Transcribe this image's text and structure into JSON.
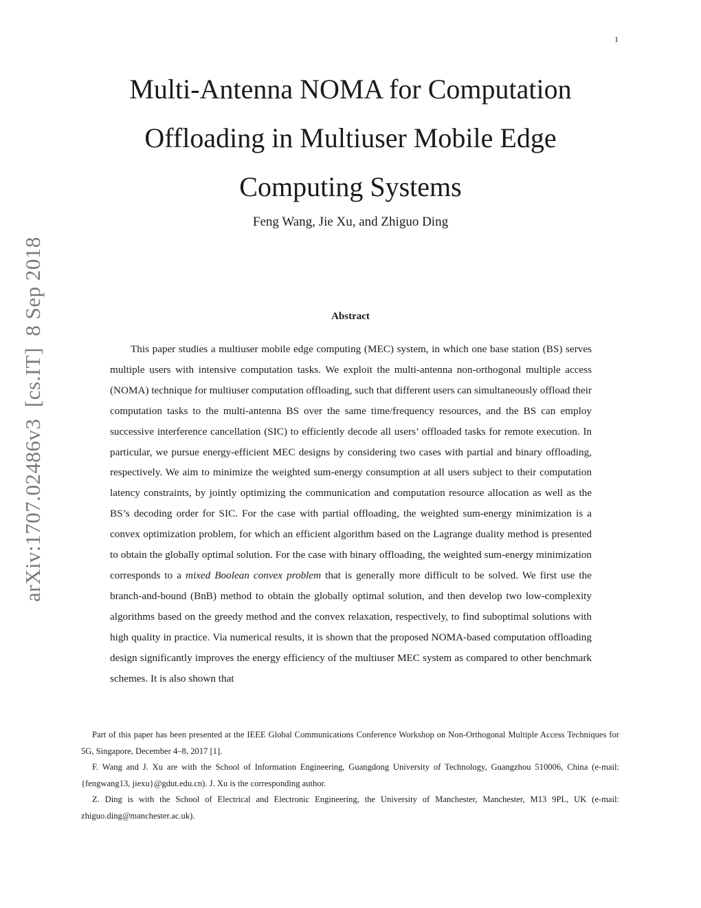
{
  "page_number": "1",
  "arxiv_stamp": "arXiv:1707.02486v3  [cs.IT]  8 Sep 2018",
  "title_lines": [
    "Multi-Antenna NOMA for Computation",
    "Offloading in Multiuser Mobile Edge",
    "Computing Systems"
  ],
  "authors": "Feng Wang, Jie Xu, and Zhiguo Ding",
  "abstract": {
    "heading": "Abstract",
    "text_before_italic": "This paper studies a multiuser mobile edge computing (MEC) system, in which one base station (BS) serves multiple users with intensive computation tasks. We exploit the multi-antenna non-orthogonal multiple access (NOMA) technique for multiuser computation offloading, such that different users can simultaneously offload their computation tasks to the multi-antenna BS over the same time/frequency resources, and the BS can employ successive interference cancellation (SIC) to efficiently decode all users’ offloaded tasks for remote execution. In particular, we pursue energy-efficient MEC designs by considering two cases with partial and binary offloading, respectively. We aim to minimize the weighted sum-energy consumption at all users subject to their computation latency constraints, by jointly optimizing the communication and computation resource allocation as well as the BS’s decoding order for SIC. For the case with partial offloading, the weighted sum-energy minimization is a convex optimization problem, for which an efficient algorithm based on the Lagrange duality method is presented to obtain the globally optimal solution. For the case with binary offloading, the weighted sum-energy minimization corresponds to a ",
    "italic_text": "mixed Boolean convex problem",
    "text_after_italic": " that is generally more difficult to be solved. We first use the branch-and-bound (BnB) method to obtain the globally optimal solution, and then develop two low-complexity algorithms based on the greedy method and the convex relaxation, respectively, to find suboptimal solutions with high quality in practice. Via numerical results, it is shown that the proposed NOMA-based computation offloading design significantly improves the energy efficiency of the multiuser MEC system as compared to other benchmark schemes. It is also shown that"
  },
  "footnotes": [
    "Part of this paper has been presented at the IEEE Global Communications Conference Workshop on Non-Orthogonal Multiple Access Techniques for 5G, Singapore, December 4–8, 2017 [1].",
    "F. Wang and J. Xu are with the School of Information Engineering, Guangdong University of Technology, Guangzhou 510006, China (e-mail: {fengwang13, jiexu}@gdut.edu.cn). J. Xu is the corresponding author.",
    "Z. Ding is with the School of Electrical and Electronic Engineering, the University of Manchester, Manchester, M13 9PL, UK (e-mail: zhiguo.ding@manchester.ac.uk)."
  ]
}
